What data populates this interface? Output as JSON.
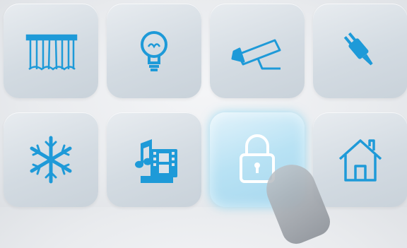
{
  "accent": "#1e9ad8",
  "tiles": [
    {
      "name": "curtain-tile",
      "icon": "curtain-icon"
    },
    {
      "name": "lighting-tile",
      "icon": "light-bulb-icon"
    },
    {
      "name": "security-camera-tile",
      "icon": "security-camera-icon"
    },
    {
      "name": "power-plug-tile",
      "icon": "power-plug-icon"
    },
    {
      "name": "climate-tile",
      "icon": "snowflake-icon"
    },
    {
      "name": "media-tile",
      "icon": "music-film-icon"
    },
    {
      "name": "lock-tile",
      "icon": "padlock-icon",
      "active": true
    },
    {
      "name": "home-tile",
      "icon": "house-icon"
    }
  ]
}
